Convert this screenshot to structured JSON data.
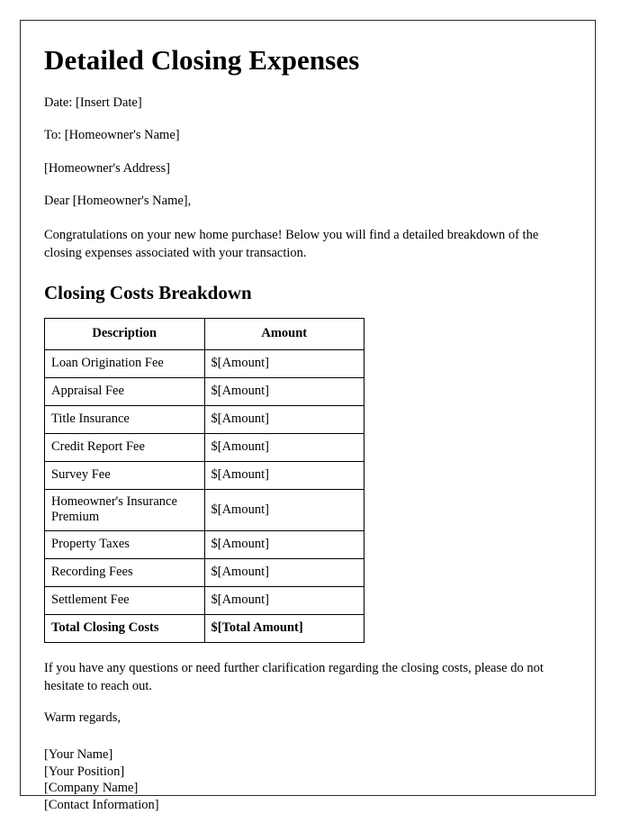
{
  "document": {
    "title": "Detailed Closing Expenses",
    "date_line": "Date: [Insert Date]",
    "to_line": "To: [Homeowner's Name]",
    "address_line": "[Homeowner's Address]",
    "salutation": "Dear [Homeowner's Name],",
    "intro_paragraph": "Congratulations on your new home purchase! Below you will find a detailed breakdown of the closing expenses associated with your transaction.",
    "section_heading": "Closing Costs Breakdown",
    "closing_paragraph": "If you have any questions or need further clarification regarding the closing costs, please do not hesitate to reach out.",
    "regards": "Warm regards,",
    "signature": {
      "name": "[Your Name]",
      "position": "[Your Position]",
      "company": "[Company Name]",
      "contact": "[Contact Information]"
    }
  },
  "table": {
    "headers": {
      "description": "Description",
      "amount": "Amount"
    },
    "rows": [
      {
        "description": "Loan Origination Fee",
        "amount": "$[Amount]"
      },
      {
        "description": "Appraisal Fee",
        "amount": "$[Amount]"
      },
      {
        "description": "Title Insurance",
        "amount": "$[Amount]"
      },
      {
        "description": "Credit Report Fee",
        "amount": "$[Amount]"
      },
      {
        "description": "Survey Fee",
        "amount": "$[Amount]"
      },
      {
        "description": "Homeowner's Insurance Premium",
        "amount": "$[Amount]"
      },
      {
        "description": "Property Taxes",
        "amount": "$[Amount]"
      },
      {
        "description": "Recording Fees",
        "amount": "$[Amount]"
      },
      {
        "description": "Settlement Fee",
        "amount": "$[Amount]"
      }
    ],
    "total": {
      "description": "Total Closing Costs",
      "amount": "$[Total Amount]"
    }
  }
}
